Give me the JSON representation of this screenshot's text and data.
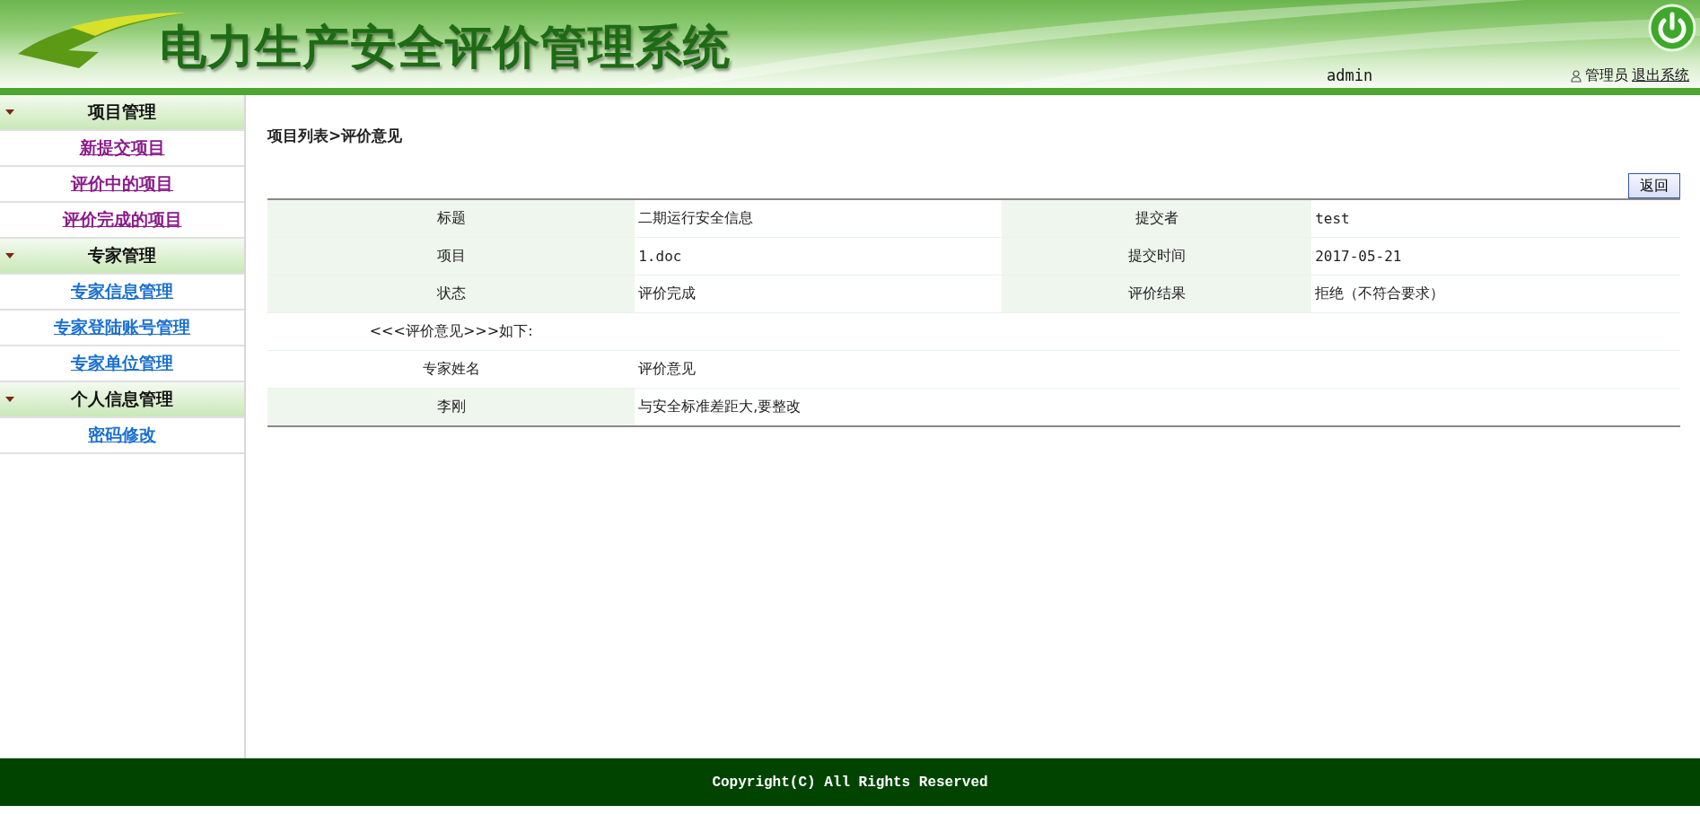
{
  "header": {
    "title": "电力生产安全评价管理系统",
    "username": "admin",
    "role": "管理员",
    "logout": "退出系统"
  },
  "sidebar": {
    "groups": [
      {
        "title": "项目管理",
        "expanded": true,
        "items": [
          {
            "label": "新提交项目",
            "visited": true
          },
          {
            "label": "评价中的项目",
            "visited": true
          },
          {
            "label": "评价完成的项目",
            "visited": true
          }
        ]
      },
      {
        "title": "专家管理",
        "expanded": true,
        "items": [
          {
            "label": "专家信息管理",
            "visited": false
          },
          {
            "label": "专家登陆账号管理",
            "visited": false
          },
          {
            "label": "专家单位管理",
            "visited": false
          }
        ]
      },
      {
        "title": "个人信息管理",
        "expanded": true,
        "items": [
          {
            "label": "密码修改",
            "visited": false
          }
        ]
      }
    ]
  },
  "breadcrumb": "项目列表>评价意见",
  "back_button": "返回",
  "details": {
    "rows": [
      [
        {
          "label": "标题",
          "value": "二期运行安全信息"
        },
        {
          "label": "提交者",
          "value": "test"
        }
      ],
      [
        {
          "label": "项目",
          "value": "1.doc"
        },
        {
          "label": "提交时间",
          "value": "2017-05-21"
        }
      ],
      [
        {
          "label": "状态",
          "value": "评价完成"
        },
        {
          "label": "评价结果",
          "value": "拒绝（不符合要求）"
        }
      ]
    ]
  },
  "opinions": {
    "heading": "<<<评价意见>>>如下:",
    "columns": [
      "专家姓名",
      "评价意见"
    ],
    "rows": [
      {
        "expert": "李刚",
        "opinion": "与安全标准差距大,要整改"
      }
    ]
  },
  "footer": "Copyright(C) All Rights Reserved"
}
